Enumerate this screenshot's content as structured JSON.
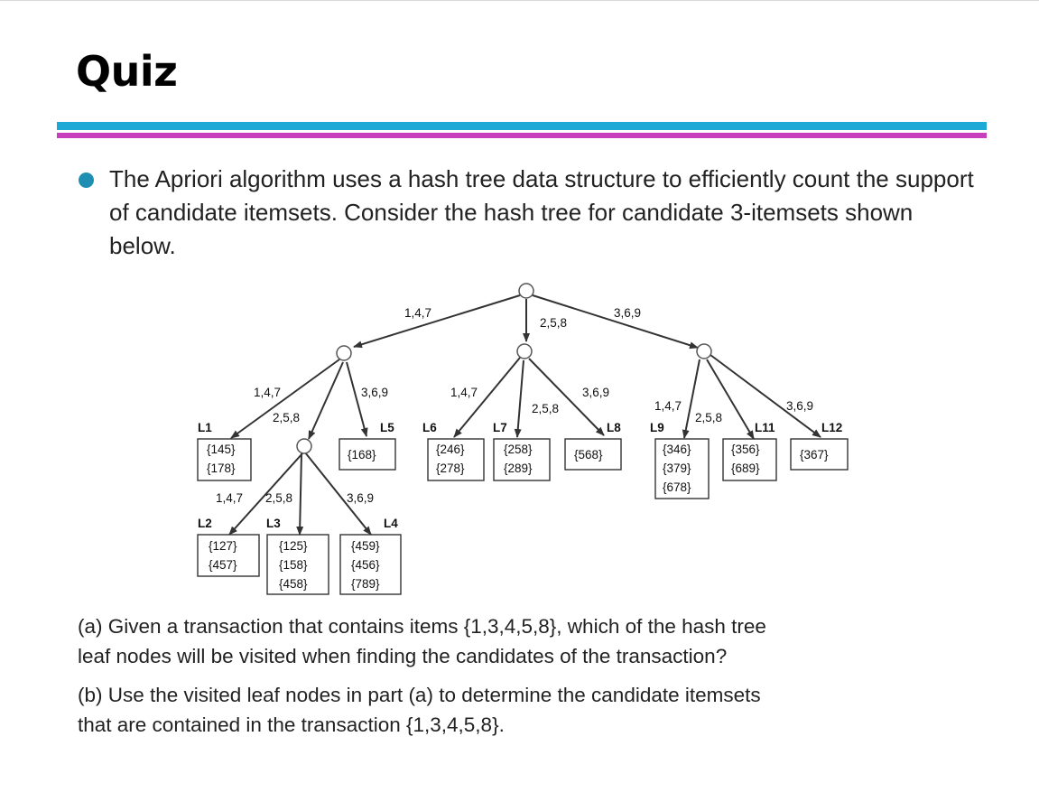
{
  "title": "Quiz",
  "bullet": "The Apriori algorithm uses a hash tree data structure to efficiently count the support of candidate itemsets. Consider the hash tree for candidate 3-itemsets shown below.",
  "questions": {
    "a_line1": "(a)  Given a transaction that contains items {1,3,4,5,8}, which of the hash tree",
    "a_line2": "leaf nodes will be visited when finding the candidates of the transaction?",
    "b_line1": "(b)  Use the visited leaf nodes in part (a) to determine the candidate itemsets",
    "b_line2": "that are contained in the transaction {1,3,4,5,8}."
  },
  "tree": {
    "edges": {
      "root_left": "1,4,7",
      "root_mid": "2,5,8",
      "root_right": "3,6,9",
      "a_left": "1,4,7",
      "a_mid": "2,5,8",
      "a_right": "3,6,9",
      "b_left": "1,4,7",
      "b_mid": "2,5,8",
      "b_right": "3,6,9",
      "c_left": "1,4,7",
      "c_mid": "2,5,8",
      "c_right": "3,6,9",
      "d_left": "1,4,7",
      "d_mid": "2,5,8",
      "d_right": "3,6,9"
    },
    "leaves": {
      "L1": {
        "name": "L1",
        "items": [
          "{145}",
          "{178}"
        ]
      },
      "L2": {
        "name": "L2",
        "items": [
          "{127}",
          "{457}"
        ]
      },
      "L3": {
        "name": "L3",
        "items": [
          "{125}",
          "{158}",
          "{458}"
        ]
      },
      "L4": {
        "name": "L4",
        "items": [
          "{459}",
          "{456}",
          "{789}"
        ]
      },
      "L5": {
        "name": "L5",
        "items": [
          "{168}"
        ]
      },
      "L6": {
        "name": "L6",
        "items": [
          "{246}",
          "{278}"
        ]
      },
      "L7": {
        "name": "L7",
        "items": [
          "{258}",
          "{289}"
        ]
      },
      "L8": {
        "name": "L8",
        "items": [
          "{568}"
        ]
      },
      "L9": {
        "name": "L9",
        "items": [
          "{346}",
          "{379}",
          "{678}"
        ]
      },
      "L11": {
        "name": "L11",
        "items": [
          "{356}",
          "{689}"
        ]
      },
      "L12": {
        "name": "L12",
        "items": [
          "{367}"
        ]
      }
    }
  }
}
